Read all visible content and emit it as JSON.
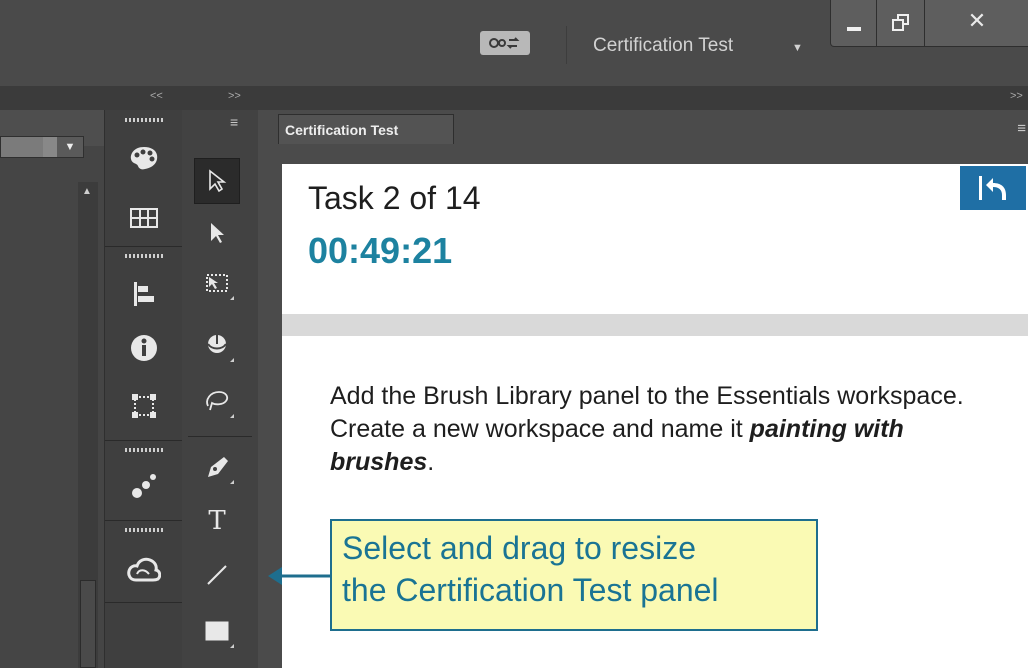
{
  "titlebar": {
    "workspace_label": "Certification Test",
    "icons": [
      "workspace-switcher-icon",
      "dropdown-caret-icon",
      "minimize-icon",
      "restore-icon",
      "close-icon"
    ]
  },
  "dock": {
    "collapse_arrow": "<<",
    "expand_arrow": ">>",
    "expand_arrow_right": ">>"
  },
  "panel": {
    "tab_label": "Certification Test",
    "task_label": "Task 2 of 14",
    "timer": "00:49:21",
    "instruction_text": "Add the Brush Library panel to the Essentials workspace. Create a new workspace and name it ",
    "instruction_emphasis": "painting with brushes",
    "instruction_end": "."
  },
  "callout": {
    "line1": "Select and drag to resize",
    "line2": "the Certification Test panel"
  },
  "colors": {
    "accent_blue": "#1d82a0",
    "back_button": "#1f6fa5",
    "callout_bg": "#fafab4",
    "callout_border": "#1e6e8e"
  }
}
